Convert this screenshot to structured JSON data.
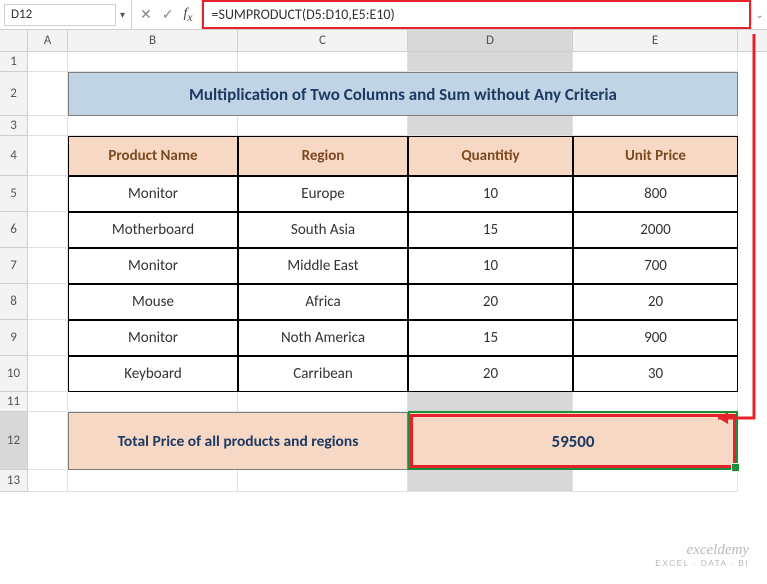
{
  "namebox": "D12",
  "formula": "=SUMPRODUCT(D5:D10,E5:E10)",
  "columns": [
    "A",
    "B",
    "C",
    "D",
    "E"
  ],
  "row_numbers": [
    1,
    2,
    3,
    4,
    5,
    6,
    7,
    8,
    9,
    10,
    11,
    12,
    13
  ],
  "title": "Multiplication of Two Columns and Sum without Any Criteria",
  "table": {
    "headers": [
      "Product Name",
      "Region",
      "Quantitiy",
      "Unit Price"
    ],
    "rows": [
      {
        "product": "Monitor",
        "region": "Europe",
        "quantity": "10",
        "unit_price": "800"
      },
      {
        "product": "Motherboard",
        "region": "South Asia",
        "quantity": "15",
        "unit_price": "2000"
      },
      {
        "product": "Monitor",
        "region": "Middle East",
        "quantity": "10",
        "unit_price": "700"
      },
      {
        "product": "Mouse",
        "region": "Africa",
        "quantity": "20",
        "unit_price": "20"
      },
      {
        "product": "Monitor",
        "region": "Noth America",
        "quantity": "15",
        "unit_price": "900"
      },
      {
        "product": "Keyboard",
        "region": "Carribean",
        "quantity": "20",
        "unit_price": "30"
      }
    ]
  },
  "total": {
    "label": "Total Price of all products and regions",
    "value": "59500"
  },
  "watermark": {
    "brand": "exceldemy",
    "sub": "EXCEL · DATA · BI"
  },
  "chart_data": {
    "type": "table",
    "title": "Multiplication of Two Columns and Sum without Any Criteria",
    "columns": [
      "Product Name",
      "Region",
      "Quantitiy",
      "Unit Price"
    ],
    "rows": [
      [
        "Monitor",
        "Europe",
        10,
        800
      ],
      [
        "Motherboard",
        "South Asia",
        15,
        2000
      ],
      [
        "Monitor",
        "Middle East",
        10,
        700
      ],
      [
        "Mouse",
        "Africa",
        20,
        20
      ],
      [
        "Monitor",
        "Noth America",
        15,
        900
      ],
      [
        "Keyboard",
        "Carribean",
        20,
        30
      ]
    ],
    "aggregate": {
      "label": "Total Price of all products and regions",
      "formula": "=SUMPRODUCT(D5:D10,E5:E10)",
      "value": 59500
    }
  }
}
